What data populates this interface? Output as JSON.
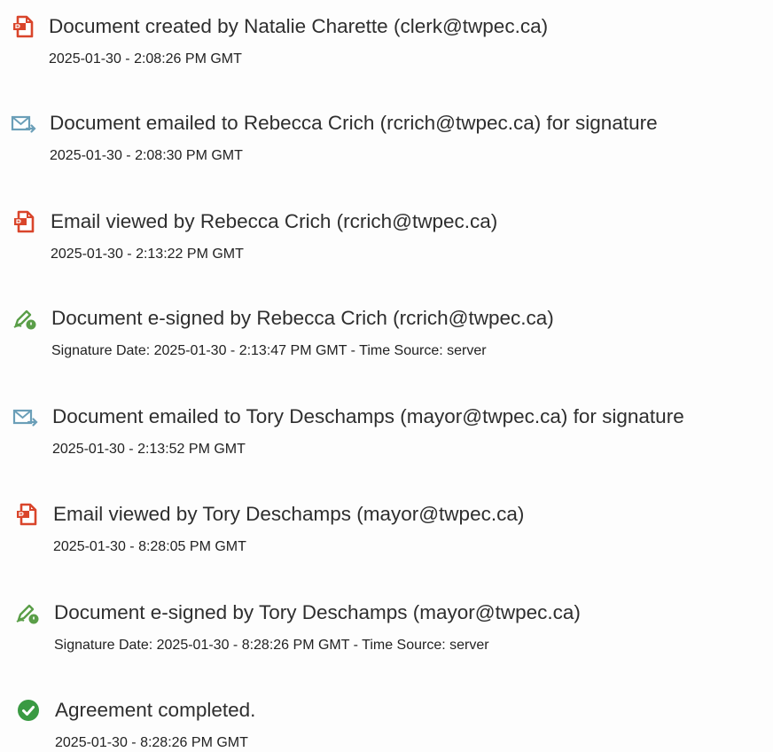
{
  "colors": {
    "created_icon": "#d9452b",
    "email_icon": "#6b9fb8",
    "sign_icon": "#5a9e48",
    "completed_icon": "#3a9a43",
    "text": "#2e2e2e"
  },
  "events": [
    {
      "icon": "pdf-document-icon",
      "title": "Document created by Natalie Charette (clerk@twpec.ca)",
      "meta": "2025-01-30 - 2:08:26 PM GMT"
    },
    {
      "icon": "email-forward-icon",
      "title": "Document emailed to Rebecca Crich (rcrich@twpec.ca) for signature",
      "meta": "2025-01-30 - 2:08:30 PM GMT"
    },
    {
      "icon": "pdf-document-icon",
      "title": "Email viewed by Rebecca Crich (rcrich@twpec.ca)",
      "meta": "2025-01-30 - 2:13:22 PM GMT"
    },
    {
      "icon": "pen-sign-icon",
      "title": "Document e-signed by Rebecca Crich (rcrich@twpec.ca)",
      "meta": "Signature Date: 2025-01-30 - 2:13:47 PM GMT - Time Source: server"
    },
    {
      "icon": "email-forward-icon",
      "title": "Document emailed to Tory Deschamps (mayor@twpec.ca) for signature",
      "meta": "2025-01-30 - 2:13:52 PM GMT"
    },
    {
      "icon": "pdf-document-icon",
      "title": "Email viewed by Tory Deschamps (mayor@twpec.ca)",
      "meta": "2025-01-30 - 8:28:05 PM GMT"
    },
    {
      "icon": "pen-sign-icon",
      "title": "Document e-signed by Tory Deschamps (mayor@twpec.ca)",
      "meta": "Signature Date: 2025-01-30 - 8:28:26 PM GMT - Time Source: server"
    },
    {
      "icon": "check-circle-icon",
      "title": "Agreement completed.",
      "meta": "2025-01-30 - 8:28:26 PM GMT"
    }
  ]
}
